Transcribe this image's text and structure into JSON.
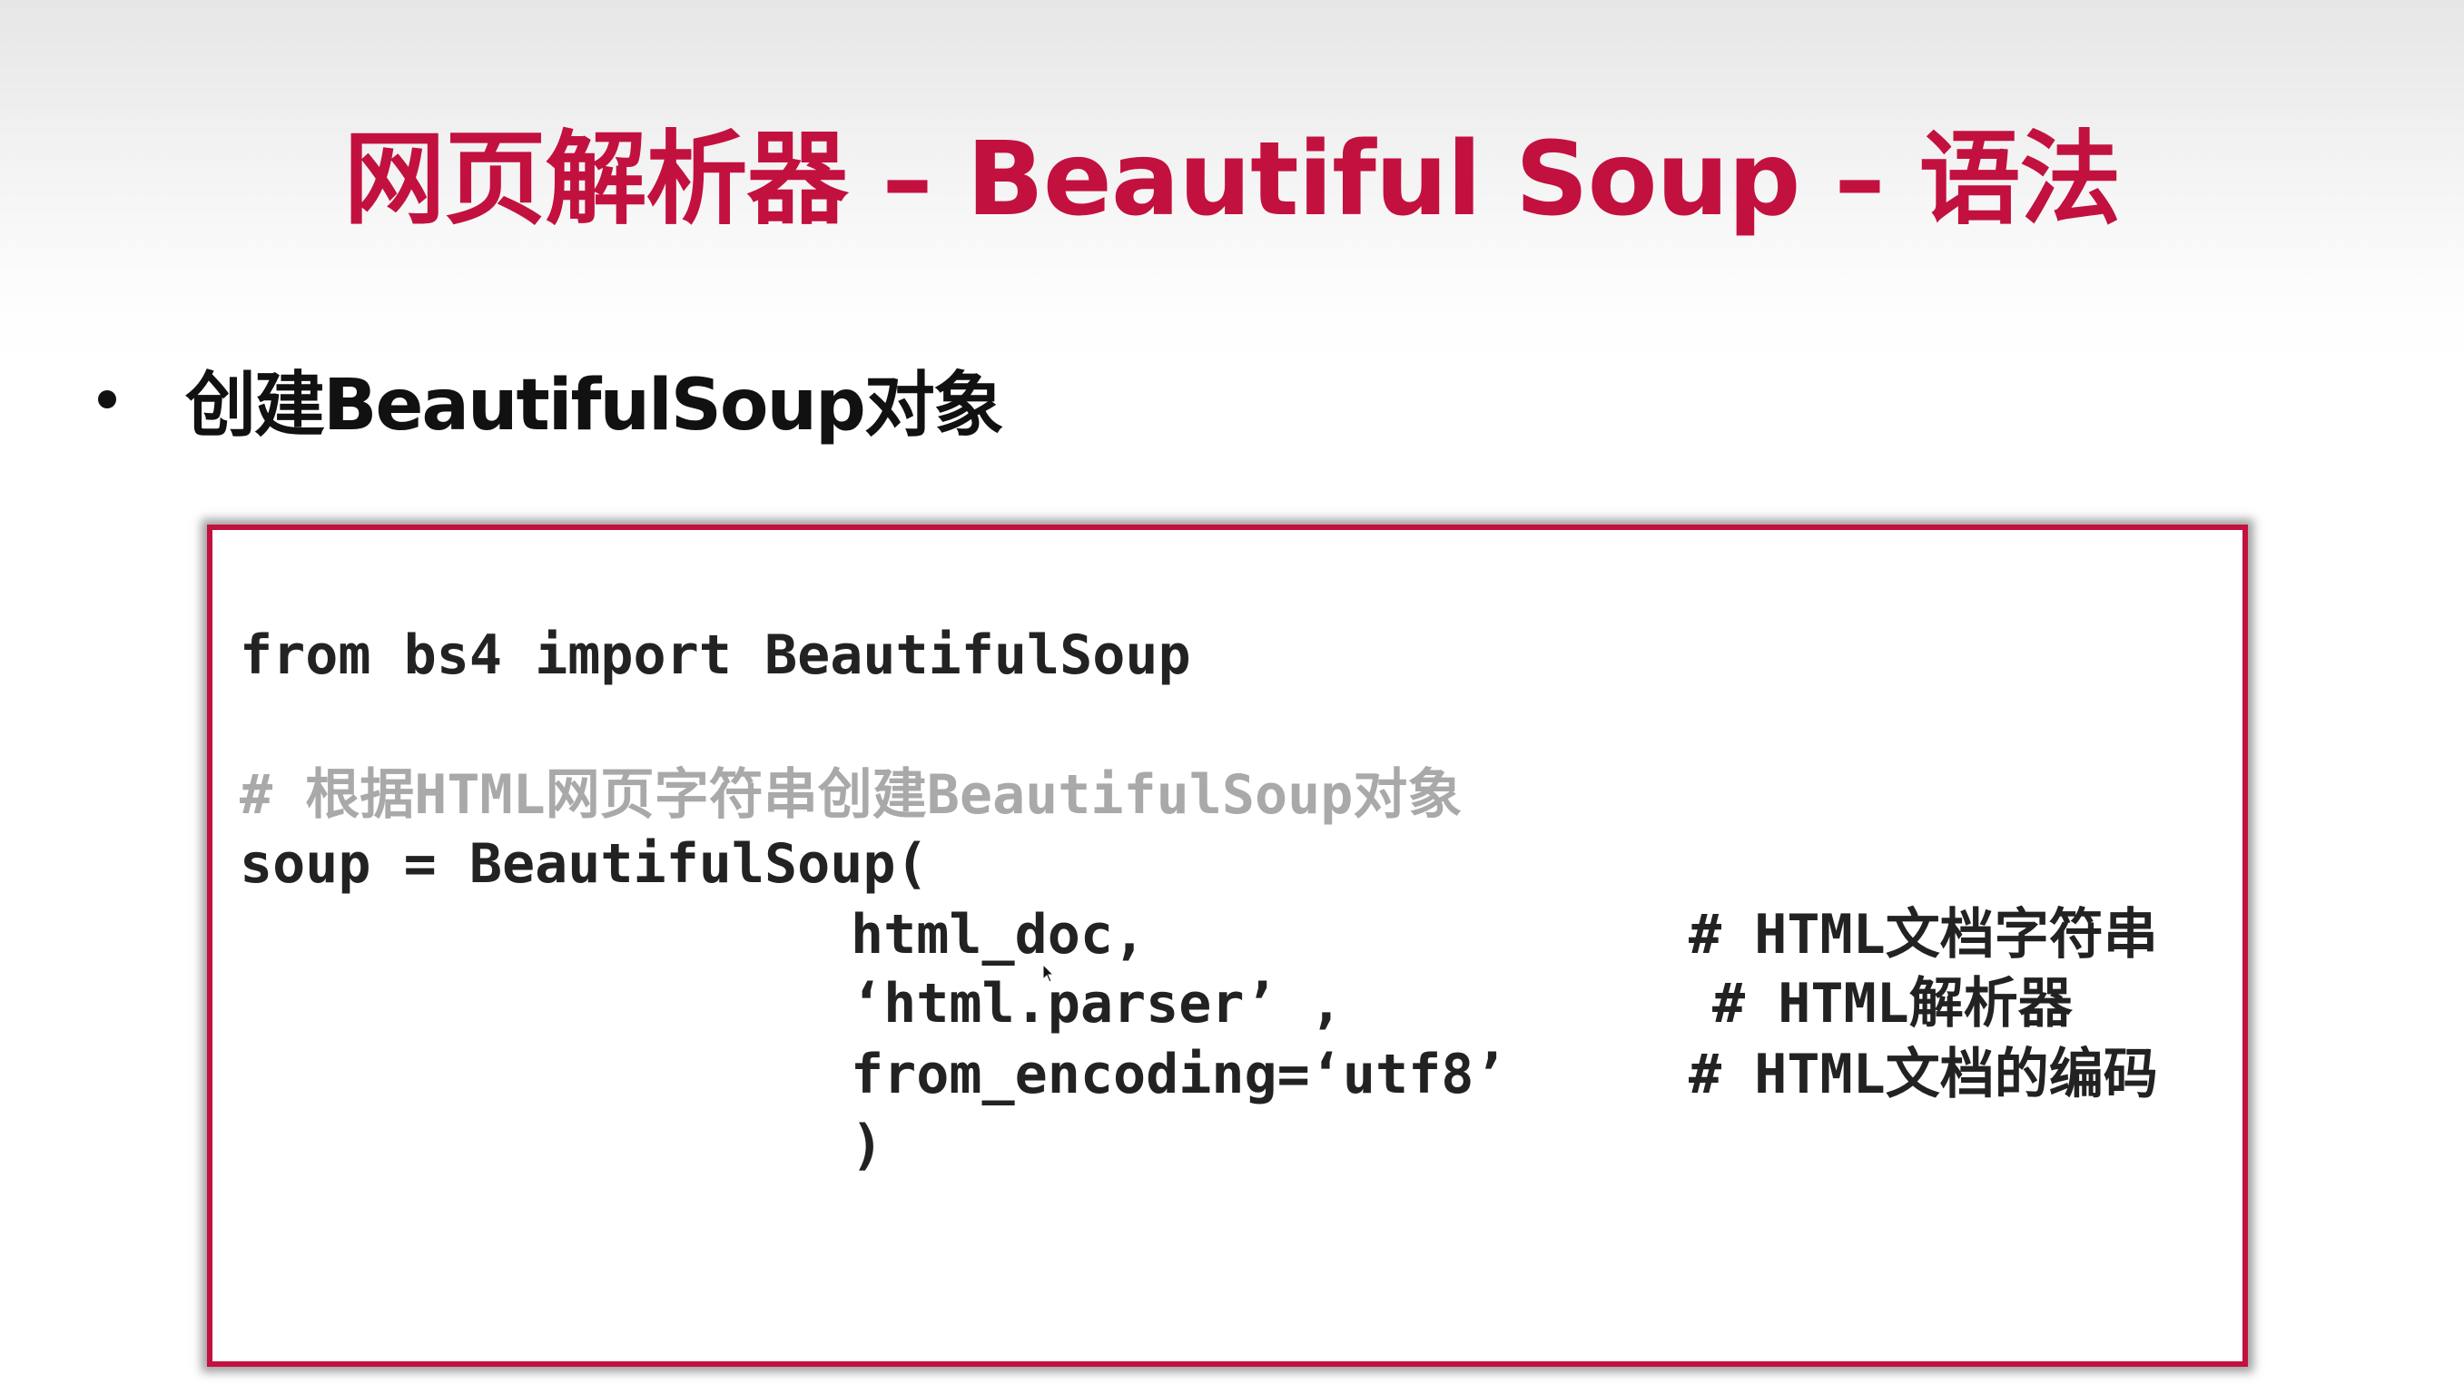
{
  "slide": {
    "title": "网页解析器 – Beautiful Soup – 语法",
    "bullet": "创建BeautifulSoup对象"
  },
  "code": {
    "line_import": "from bs4 import BeautifulSoup",
    "line_comment": "# 根据HTML网页字符串创建BeautifulSoup对象",
    "line_soup": "soup = BeautifulSoup(",
    "arg1": "html_doc,",
    "arg2": "‘html.parser’ ,",
    "arg3": "from_encoding=‘utf8’",
    "close_paren": ")",
    "comment1": "# HTML文档字符串",
    "comment2": "# HTML解析器",
    "comment3": "# HTML文档的编码"
  },
  "colors": {
    "accent": "#c2113f",
    "text": "#222222",
    "comment": "#a9a9a9"
  },
  "icons": {
    "cursor": "mouse-pointer-icon"
  }
}
